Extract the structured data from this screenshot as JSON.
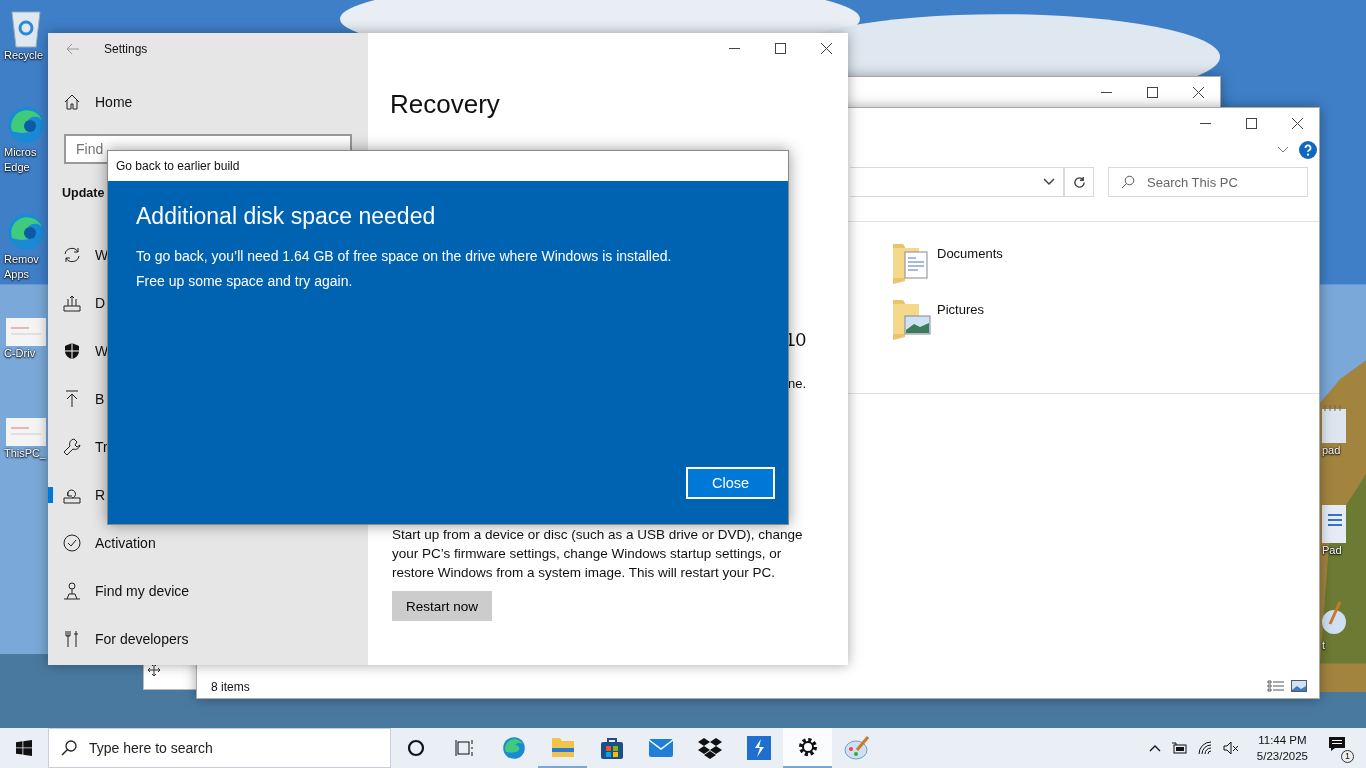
{
  "desktop_icons_left": [
    {
      "kind": "recycle",
      "lines": [
        "Recycle"
      ]
    },
    {
      "kind": "edge",
      "lines": [
        "Micros",
        "Edge"
      ]
    },
    {
      "kind": "edge",
      "lines": [
        "Remov",
        "Apps"
      ]
    },
    {
      "kind": "thumb",
      "lines": [
        "C-Driv"
      ]
    },
    {
      "kind": "thumb",
      "lines": [
        "ThisPC_"
      ]
    }
  ],
  "desktop_icons_right": [
    {
      "kind": "notepad",
      "lines": [
        "pad"
      ]
    },
    {
      "kind": "wordpad",
      "lines": [
        "Pad"
      ]
    },
    {
      "kind": "paint",
      "lines": [
        "t"
      ]
    }
  ],
  "settings": {
    "title": "Settings",
    "home": "Home",
    "search": {
      "placeholder": "Find"
    },
    "section": "Update",
    "items": [
      {
        "kind": "sync",
        "label": "W",
        "selected": false
      },
      {
        "kind": "delivery",
        "label": "D",
        "selected": false
      },
      {
        "kind": "shield",
        "label": "W",
        "selected": false
      },
      {
        "kind": "backup",
        "label": "B",
        "selected": false
      },
      {
        "kind": "wrench",
        "label": "Tr",
        "selected": false
      },
      {
        "kind": "recovery",
        "label": "R",
        "selected": true
      },
      {
        "kind": "check",
        "label": "Activation",
        "selected": false
      },
      {
        "kind": "person",
        "label": "Find my device",
        "selected": false
      },
      {
        "kind": "dev",
        "label": "For developers",
        "selected": false
      }
    ],
    "page_title": "Recovery",
    "fragment_heading": "10",
    "fragment_text": "ne.",
    "description": "Start up from a device or disc (such as a USB drive or DVD), change your PC’s firmware settings, change Windows startup settings, or restore Windows from a system image. This will restart your PC.",
    "restart_button": "Restart now"
  },
  "dialog": {
    "title": "Go back to earlier build",
    "heading": "Additional disk space needed",
    "lines": [
      "To go back, you’ll need 1.64 GB of free space on the drive where Windows is installed.",
      "Free up some space and try again."
    ],
    "close_button": "Close"
  },
  "explorer": {
    "search": {
      "placeholder": "Search This PC"
    },
    "items": [
      {
        "kind": "documents",
        "label": "Documents"
      },
      {
        "kind": "pictures",
        "label": "Pictures"
      }
    ],
    "status": "8 items"
  },
  "taskbar": {
    "search": {
      "placeholder": "Type here to search"
    },
    "apps": [
      {
        "kind": "cortana",
        "open": false,
        "selected": false
      },
      {
        "kind": "taskview",
        "open": false,
        "selected": false
      },
      {
        "kind": "edge",
        "open": false,
        "selected": false
      },
      {
        "kind": "explorer",
        "open": true,
        "selected": false
      },
      {
        "kind": "store",
        "open": false,
        "selected": false
      },
      {
        "kind": "mail",
        "open": false,
        "selected": false
      },
      {
        "kind": "dropbox",
        "open": false,
        "selected": false
      },
      {
        "kind": "bluebox",
        "open": false,
        "selected": false
      },
      {
        "kind": "settings",
        "open": true,
        "selected": true
      },
      {
        "kind": "paint",
        "open": false,
        "selected": false
      }
    ],
    "time": "11:44 PM",
    "date": "5/23/2025",
    "notifications": "1"
  }
}
